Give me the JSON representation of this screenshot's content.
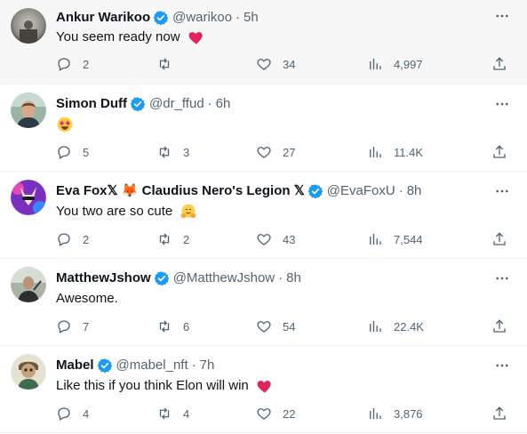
{
  "tweets": [
    {
      "name": "Ankur Warikoo",
      "handle": "@warikoo",
      "time": "5h",
      "text": "You seem ready now",
      "emoji": "red-heart",
      "reply_count": "2",
      "retweet_count": "",
      "like_count": "34",
      "view_count": "4,997"
    },
    {
      "name": "Simon Duff",
      "handle": "@dr_ffud",
      "time": "6h",
      "text": "",
      "emoji": "star-struck-face",
      "reply_count": "5",
      "retweet_count": "3",
      "like_count": "27",
      "view_count": "11.4K"
    },
    {
      "name": "Eva Fox𝕏 🦊 Claudius Nero's Legion 𝕏",
      "handle": "@EvaFoxU",
      "time": "8h",
      "text": "You two are so cute",
      "emoji": "hugging-face",
      "reply_count": "2",
      "retweet_count": "2",
      "like_count": "43",
      "view_count": "7,544"
    },
    {
      "name": "MatthewJshow",
      "handle": "@MatthewJshow",
      "time": "8h",
      "text": "Awesome.",
      "emoji": "",
      "reply_count": "7",
      "retweet_count": "6",
      "like_count": "54",
      "view_count": "22.4K"
    },
    {
      "name": "Mabel",
      "handle": "@mabel_nft",
      "time": "7h",
      "text": "Like this if you think Elon will win",
      "emoji": "red-heart",
      "reply_count": "4",
      "retweet_count": "4",
      "like_count": "22",
      "view_count": "3,876"
    }
  ],
  "separator": "·",
  "colors": {
    "verified_blue": "#1d9bf0",
    "secondary_text": "#536471",
    "primary_text": "#0f1419",
    "heart_red": "#e0245e"
  }
}
